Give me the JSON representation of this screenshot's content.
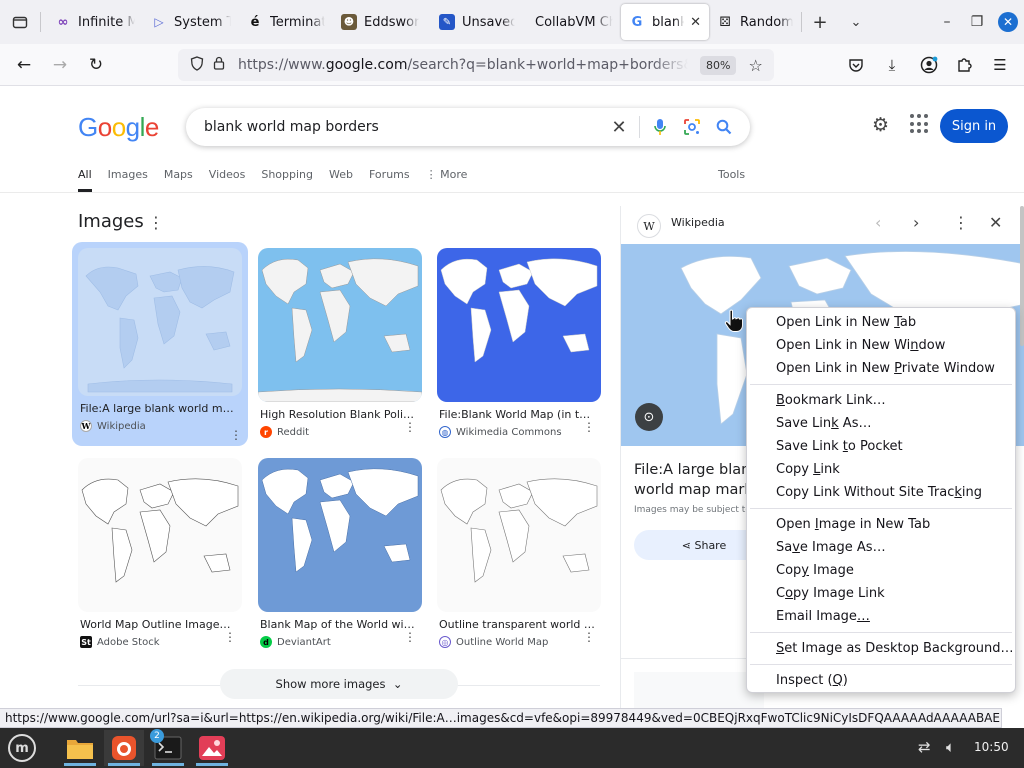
{
  "browser": {
    "tabs": [
      {
        "title": "Infinite M",
        "icon": "infinity-icon"
      },
      {
        "title": "System T",
        "icon": "play-icon"
      },
      {
        "title": "Terminat",
        "icon": "e-logo-icon"
      },
      {
        "title": "Eddswor",
        "icon": "character-icon"
      },
      {
        "title": "Unsaved",
        "icon": "edit-icon"
      },
      {
        "title": "CollabVM Ch",
        "icon": ""
      },
      {
        "title": "blank",
        "icon": "google-icon"
      },
      {
        "title": "Random",
        "icon": "dice-icon"
      }
    ],
    "url_prefix": "https://www.",
    "url_host": "google.com",
    "url_rest": "/search?q=blank+world+map+borders&client=f",
    "zoom": "80%"
  },
  "google": {
    "logo": [
      "G",
      "o",
      "o",
      "g",
      "l",
      "e"
    ],
    "logo_colors": [
      "#4285f4",
      "#ea4335",
      "#fbbc05",
      "#4285f4",
      "#34a853",
      "#ea4335"
    ],
    "query": "blank world map borders",
    "sign_in": "Sign in",
    "filters": [
      "All",
      "Images",
      "Maps",
      "Videos",
      "Shopping",
      "Web",
      "Forums",
      "⋮ More"
    ],
    "tools": "Tools",
    "images_heading": "Images",
    "show_more": "Show more images",
    "results": [
      {
        "caption": "File:A large blank world map ...",
        "source": "Wikipedia"
      },
      {
        "caption": "High Resolution Blank Politic...",
        "source": "Reddit"
      },
      {
        "caption": "File:Blank World Map (in the ...",
        "source": "Wikimedia Commons"
      },
      {
        "caption": "World Map Outline Images – ...",
        "source": "Adobe Stock"
      },
      {
        "caption": "Blank Map of the World witho...",
        "source": "DeviantArt"
      },
      {
        "caption": "Outline transparent world ma...",
        "source": "Outline World Map"
      }
    ],
    "side_panel": {
      "source": "Wikipedia",
      "title": "File:A large blank world map marked in blue.PNG",
      "note": "Images may be subject to copyright.",
      "share": "Share"
    }
  },
  "context_menu": {
    "group1": [
      [
        "Open Link in New ",
        "T",
        "ab"
      ],
      [
        "Open Link in New Wi",
        "n",
        "dow"
      ],
      [
        "Open Link in New ",
        "P",
        "rivate Window"
      ]
    ],
    "group2": [
      [
        "",
        "B",
        "ookmark Link…"
      ],
      [
        "Save Lin",
        "k",
        " As…"
      ],
      [
        "Save Link ",
        "t",
        "o Pocket"
      ],
      [
        "Copy ",
        "L",
        "ink"
      ],
      [
        "Copy Link Without Site Trac",
        "k",
        "ing"
      ]
    ],
    "group3": [
      [
        "Open ",
        "I",
        "mage in New Tab"
      ],
      [
        "Sa",
        "v",
        "e Image As…"
      ],
      [
        "Cop",
        "y",
        " Image"
      ],
      [
        "C",
        "o",
        "py Image Link"
      ],
      [
        "Email Image",
        "…",
        ""
      ]
    ],
    "group4": [
      [
        "",
        "S",
        "et Image as Desktop Background…"
      ]
    ],
    "group5": [
      [
        "Inspect (",
        "Q",
        ")"
      ]
    ]
  },
  "status_url": "https://www.google.com/url?sa=i&url=https://en.wikipedia.org/wiki/File:A…images&cd=vfe&opi=89978449&ved=0CBEQjRxqFwoTClic9NiCyIsDFQAAAAAdAAAAABAE",
  "taskbar": {
    "terminal_badge": "2",
    "clock": "10:50"
  }
}
